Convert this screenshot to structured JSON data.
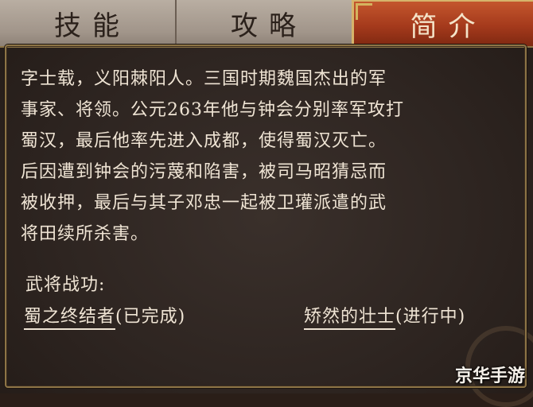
{
  "tabs": [
    {
      "label": "技能",
      "active": false
    },
    {
      "label": "攻略",
      "active": false
    },
    {
      "label": "简介",
      "active": true
    }
  ],
  "bio": {
    "lines": [
      "字士载，义阳棘阳人。三国时期魏国杰出的军",
      "事家、将领。公元263年他与钟会分别率军攻打",
      "蜀汉，最后他率先进入成都，使得蜀汉灭亡。",
      "后因遭到钟会的污蔑和陷害，被司马昭猜忌而",
      "被收押，最后与其子邓忠一起被卫瓘派遣的武",
      "将田续所杀害。"
    ]
  },
  "achievements": {
    "title": "武将战功:",
    "items": [
      {
        "name": "蜀之终结者",
        "status": "(已完成)"
      },
      {
        "name": "矫然的壮士",
        "status": "(进行中)"
      }
    ]
  },
  "watermark": "京华手游",
  "colors": {
    "active_tab": "#a53a1c",
    "border_gold": "#8d7446",
    "text": "#efe4d4"
  }
}
